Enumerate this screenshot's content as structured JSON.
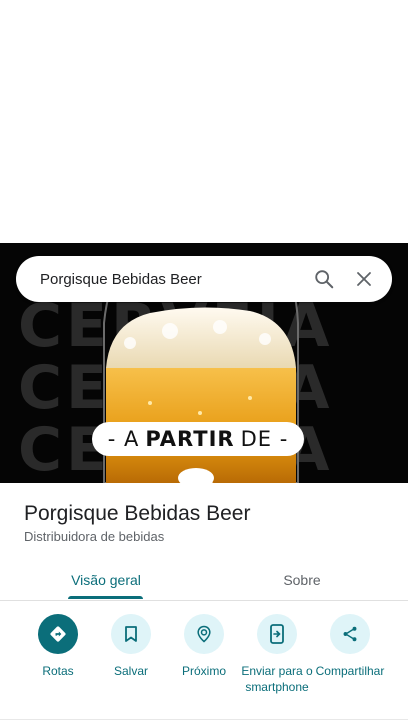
{
  "search": {
    "query": "Porgisque Bebidas Beer",
    "search_icon": "search-icon",
    "close_icon": "close-icon"
  },
  "hero": {
    "background_words": [
      "CERVEJA",
      "CERVEJA",
      "CERVEJA"
    ],
    "promo_pre": "- A",
    "promo_bold": "PARTIR",
    "promo_post": "DE -"
  },
  "place": {
    "title": "Porgisque Bebidas Beer",
    "category": "Distribuidora de bebidas"
  },
  "tabs": [
    {
      "label": "Visão geral",
      "active": true
    },
    {
      "label": "Sobre",
      "active": false
    }
  ],
  "actions": [
    {
      "label": "Rotas",
      "icon": "directions-icon"
    },
    {
      "label": "Salvar",
      "icon": "bookmark-icon"
    },
    {
      "label": "Próximo",
      "icon": "nearby-icon"
    },
    {
      "label": "Enviar para o smartphone",
      "icon": "send-to-phone-icon"
    },
    {
      "label": "Compartilhar",
      "icon": "share-icon"
    }
  ],
  "colors": {
    "accent": "#0b6e7a",
    "action_bg": "#dff4f8",
    "beer": "#e8a21a",
    "foam": "#f3ebd6"
  }
}
